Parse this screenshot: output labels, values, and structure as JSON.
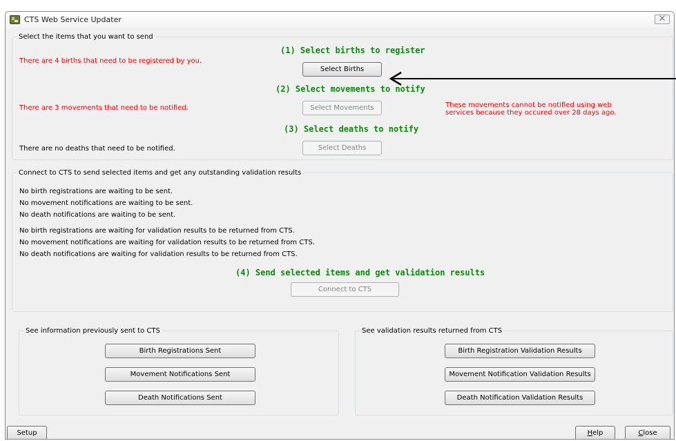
{
  "window": {
    "title": "CTS Web Service Updater",
    "close_glyph": "⨉"
  },
  "select_group": {
    "legend": "Select the items that you want to send",
    "births": {
      "step": "(1) Select births to register",
      "status": "There are 4 births that need to be registered by you.",
      "button": "Select Births"
    },
    "movements": {
      "step": "(2) Select movements to notify",
      "status": "There are 3 movements that need to be notified.",
      "button": "Select Movements",
      "warning_line1": "These movements cannot be notified using web",
      "warning_line2": "services because they occured over 28 days ago."
    },
    "deaths": {
      "step": "(3) Select deaths to notify",
      "status": "There are no deaths that need to be notified.",
      "button": "Select Deaths"
    }
  },
  "connect_group": {
    "legend": "Connect to CTS to send selected items and get any outstanding validation results",
    "lines": [
      "No birth registrations are waiting to be sent.",
      "No movement notifications are waiting to be sent.",
      "No death notifications are waiting to be sent.",
      "No birth registrations are waiting for validation results to be returned from CTS.",
      "No movement notifications are waiting for validation results to be returned from CTS.",
      "No death notifications are waiting for validation results to be returned from CTS."
    ],
    "step": "(4) Send selected items and get validation results",
    "button": "Connect to CTS"
  },
  "sent_group": {
    "legend": "See information previously sent to CTS",
    "buttons": [
      "Birth Registrations Sent",
      "Movement Notifications Sent",
      "Death Notifications Sent"
    ]
  },
  "results_group": {
    "legend": "See validation results returned from CTS",
    "buttons": [
      "Birth Registration Validation Results",
      "Movement Notification Validation Results",
      "Death Notification Validation Results"
    ]
  },
  "footer": {
    "setup": "Setup",
    "help_first": "H",
    "help_rest": "elp",
    "close_first": "C",
    "close_rest": "lose"
  },
  "colors": {
    "status_red": "#ff0000",
    "step_green": "#0b8a0b",
    "window_bg": "#f0f0f0"
  }
}
